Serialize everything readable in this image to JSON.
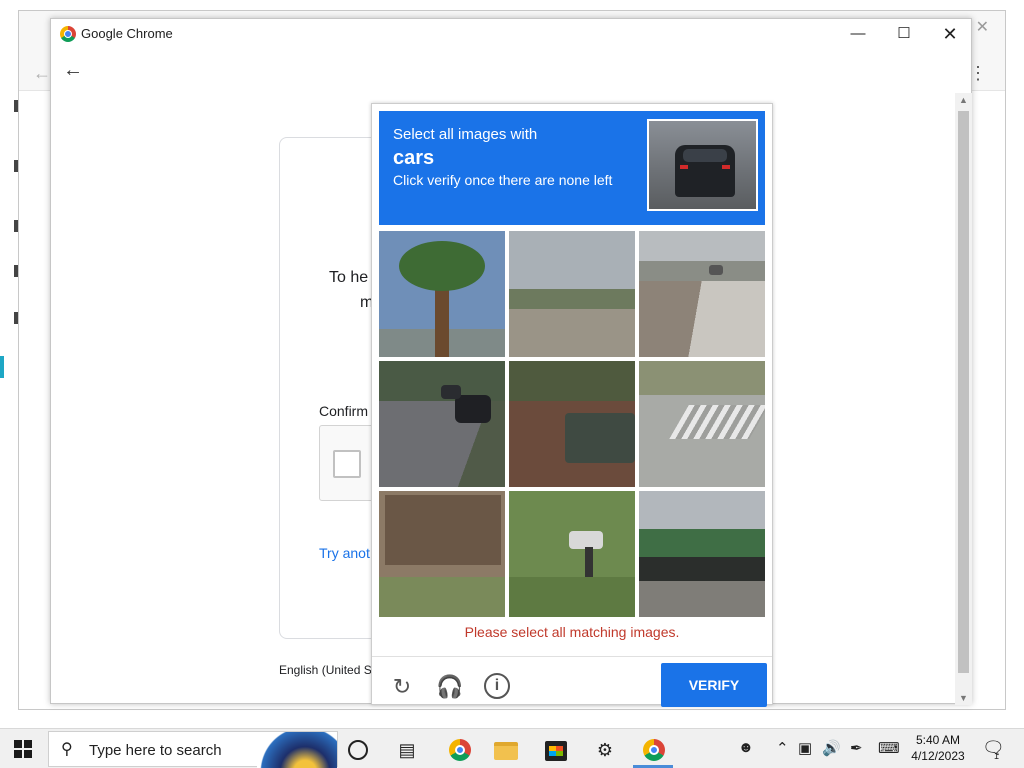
{
  "window": {
    "title": "Google Chrome"
  },
  "page": {
    "text_line1": "To he",
    "text_line2": "m",
    "confirm_label": "Confirm",
    "try_another": "Try anot",
    "language": "English (United S"
  },
  "captcha": {
    "prompt_line1": "Select all images with",
    "target": "cars",
    "prompt_line3": "Click verify once there are none left",
    "error": "Please select all matching images.",
    "verify_label": "VERIFY",
    "accent_color": "#1a73e8",
    "error_color": "#c0392b",
    "footer_icons": [
      "refresh-icon",
      "headphones-icon",
      "info-icon"
    ]
  },
  "taskbar": {
    "search_placeholder": "Type here to search",
    "time": "5:40 AM",
    "date": "4/12/2023",
    "notification_count": "1",
    "pinned_icons": [
      "cortana-icon",
      "task-view-icon",
      "chrome-icon",
      "file-explorer-icon",
      "store-icon",
      "settings-icon",
      "chrome-icon"
    ]
  }
}
